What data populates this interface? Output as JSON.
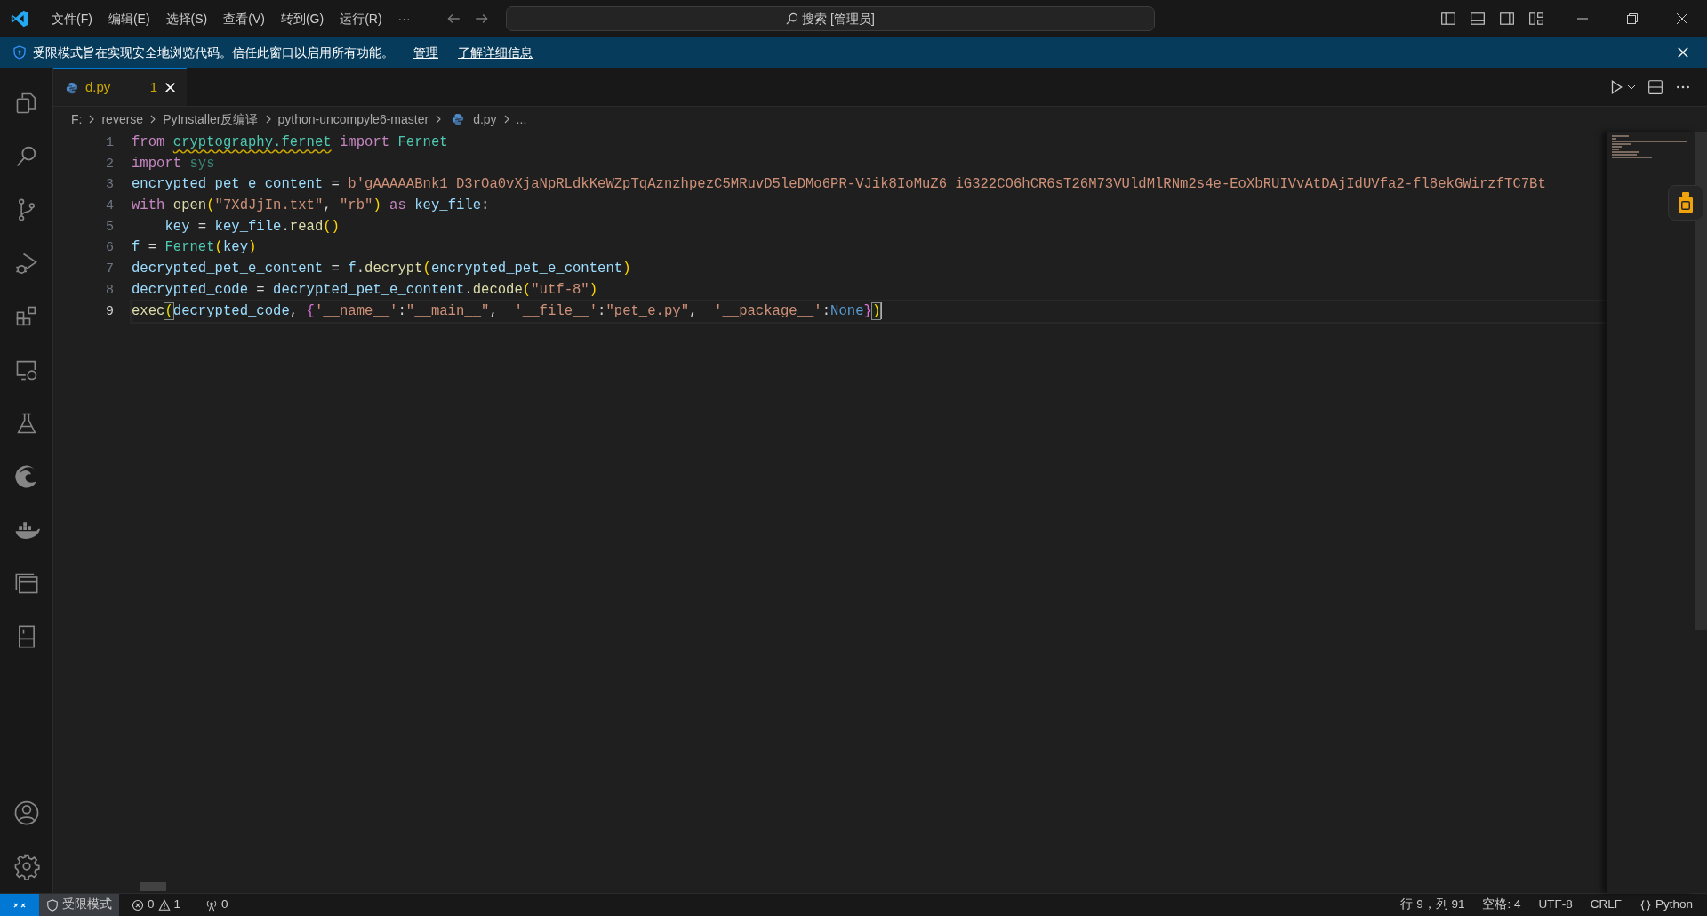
{
  "menu": [
    "文件(F)",
    "编辑(E)",
    "选择(S)",
    "查看(V)",
    "转到(G)",
    "运行(R)",
    "···"
  ],
  "command_center": "搜索 [管理员]",
  "banner": {
    "message": "受限模式旨在实现安全地浏览代码。信任此窗口以启用所有功能。",
    "links": [
      "管理",
      "了解详细信息"
    ]
  },
  "tabs": [
    {
      "label": "d.py",
      "problems": "1",
      "selected": true
    }
  ],
  "breadcrumb": [
    "F:",
    "reverse",
    "PyInstaller反编译",
    "python-uncompyle6-master",
    "d.py",
    "..."
  ],
  "editor": {
    "lines": [
      {
        "number": "1",
        "current": false,
        "indented": false,
        "tokens": [
          {
            "kind": "kw",
            "text": "from "
          },
          {
            "kind": "mod",
            "text": "cryptography.fernet",
            "warning": true
          },
          {
            "kind": "kw",
            "text": " import "
          },
          {
            "kind": "cls",
            "text": "Fernet"
          }
        ]
      },
      {
        "number": "2",
        "current": false,
        "indented": false,
        "tokens": [
          {
            "kind": "kw",
            "text": "import "
          },
          {
            "kind": "dim",
            "text": "sys"
          }
        ]
      },
      {
        "number": "3",
        "current": false,
        "indented": false,
        "tokens": [
          {
            "kind": "var",
            "text": "encrypted_pet_e_content"
          },
          {
            "kind": "op",
            "text": " = "
          },
          {
            "kind": "str",
            "text": "b'gAAAAABnk1_D3rOa0vXjaNpRLdkKeWZpTqAznzhpezC5MRuvD5leDMo6PR-VJik8IoMuZ6_iG322CO6hCR6sT26M73VUldMlRNm2s4e-EoXbRUIVvAtDAjIdUVfa2-fl8ekGWirzfTC7Bt"
          }
        ]
      },
      {
        "number": "4",
        "current": false,
        "indented": false,
        "tokens": [
          {
            "kind": "kw",
            "text": "with "
          },
          {
            "kind": "fn",
            "text": "open"
          },
          {
            "kind": "b1",
            "text": "("
          },
          {
            "kind": "str",
            "text": "\"7XdJjIn.txt\""
          },
          {
            "kind": "op",
            "text": ", "
          },
          {
            "kind": "str",
            "text": "\"rb\""
          },
          {
            "kind": "b1",
            "text": ")"
          },
          {
            "kind": "kw",
            "text": " as "
          },
          {
            "kind": "var",
            "text": "key_file"
          },
          {
            "kind": "op",
            "text": ":"
          }
        ]
      },
      {
        "number": "5",
        "current": false,
        "indented": true,
        "tokens": [
          {
            "kind": "var",
            "text": "key"
          },
          {
            "kind": "op",
            "text": " = "
          },
          {
            "kind": "var",
            "text": "key_file"
          },
          {
            "kind": "op",
            "text": "."
          },
          {
            "kind": "fn",
            "text": "read"
          },
          {
            "kind": "b1",
            "text": "()"
          }
        ]
      },
      {
        "number": "6",
        "current": false,
        "indented": false,
        "tokens": [
          {
            "kind": "var",
            "text": "f"
          },
          {
            "kind": "op",
            "text": " = "
          },
          {
            "kind": "cls",
            "text": "Fernet"
          },
          {
            "kind": "b1",
            "text": "("
          },
          {
            "kind": "var",
            "text": "key"
          },
          {
            "kind": "b1",
            "text": ")"
          }
        ]
      },
      {
        "number": "7",
        "current": false,
        "indented": false,
        "tokens": [
          {
            "kind": "var",
            "text": "decrypted_pet_e_content"
          },
          {
            "kind": "op",
            "text": " = "
          },
          {
            "kind": "var",
            "text": "f"
          },
          {
            "kind": "op",
            "text": "."
          },
          {
            "kind": "fn",
            "text": "decrypt"
          },
          {
            "kind": "b1",
            "text": "("
          },
          {
            "kind": "var",
            "text": "encrypted_pet_e_content"
          },
          {
            "kind": "b1",
            "text": ")"
          }
        ]
      },
      {
        "number": "8",
        "current": false,
        "indented": false,
        "tokens": [
          {
            "kind": "var",
            "text": "decrypted_code"
          },
          {
            "kind": "op",
            "text": " = "
          },
          {
            "kind": "var",
            "text": "decrypted_pet_e_content"
          },
          {
            "kind": "op",
            "text": "."
          },
          {
            "kind": "fn",
            "text": "decode"
          },
          {
            "kind": "b1",
            "text": "("
          },
          {
            "kind": "str",
            "text": "\"utf-8\""
          },
          {
            "kind": "b1",
            "text": ")"
          }
        ]
      },
      {
        "number": "9",
        "current": true,
        "indented": false,
        "tokens": [
          {
            "kind": "fn",
            "text": "exec"
          },
          {
            "kind": "b1",
            "text": "(",
            "matched": true
          },
          {
            "kind": "var",
            "text": "decrypted_code"
          },
          {
            "kind": "op",
            "text": ", "
          },
          {
            "kind": "b2",
            "text": "{"
          },
          {
            "kind": "str",
            "text": "'__name__'"
          },
          {
            "kind": "op",
            "text": ":"
          },
          {
            "kind": "str",
            "text": "\"__main__\""
          },
          {
            "kind": "op",
            "text": ",  "
          },
          {
            "kind": "str",
            "text": "'__file__'"
          },
          {
            "kind": "op",
            "text": ":"
          },
          {
            "kind": "str",
            "text": "\"pet_e.py\""
          },
          {
            "kind": "op",
            "text": ",  "
          },
          {
            "kind": "str",
            "text": "'__package__'"
          },
          {
            "kind": "op",
            "text": ":"
          },
          {
            "kind": "const",
            "text": "None"
          },
          {
            "kind": "b2",
            "text": "}"
          },
          {
            "kind": "b1",
            "text": ")",
            "matched": true
          }
        ]
      }
    ]
  },
  "status_bar": {
    "mode": "受限模式",
    "errors": "0",
    "warnings": "1",
    "ports": "0",
    "right": [
      {
        "kind": "text",
        "label": "行 9，列 91"
      },
      {
        "kind": "text",
        "label": "空格: 4"
      },
      {
        "kind": "text",
        "label": "UTF-8"
      },
      {
        "kind": "text",
        "label": "CRLF"
      },
      {
        "kind": "language",
        "label": "Python"
      }
    ]
  }
}
